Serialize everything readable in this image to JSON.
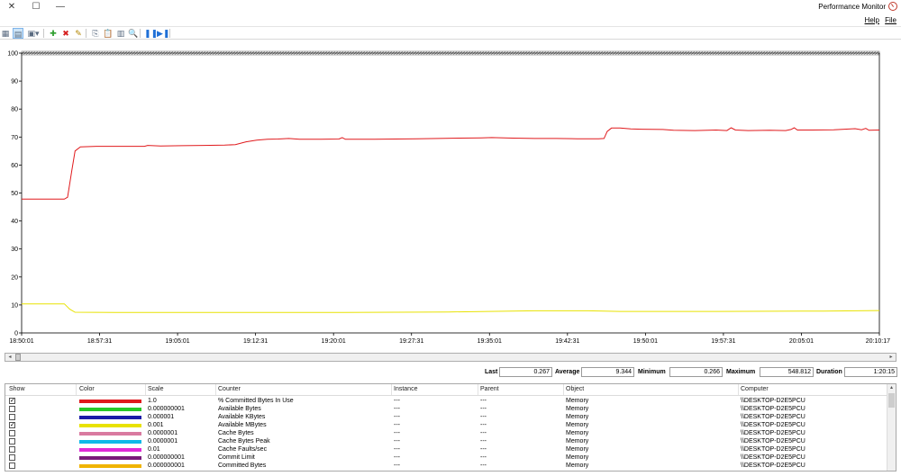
{
  "window": {
    "title": "Performance Monitor",
    "controls": {
      "close": "✕",
      "maximize": "☐",
      "minimize": "—"
    }
  },
  "menu": {
    "items": [
      "Help",
      "File"
    ]
  },
  "toolbar": {
    "tools": [
      {
        "name": "change-graph-type-icon",
        "glyph": "▦",
        "active": false
      },
      {
        "name": "view-current-activity-icon",
        "glyph": "▤",
        "active": true
      },
      {
        "name": "change-graph-type-dropdown-icon",
        "glyph": "▣▾",
        "active": false
      },
      {
        "name": "add-counter-icon",
        "glyph": "✚",
        "active": false,
        "color": "#2e9e2e"
      },
      {
        "name": "delete-counter-icon",
        "glyph": "✖",
        "active": false,
        "color": "#d62020"
      },
      {
        "name": "highlight-icon",
        "glyph": "✎",
        "active": false,
        "color": "#b38600"
      },
      {
        "name": "copy-properties-icon",
        "glyph": "⎘",
        "active": false
      },
      {
        "name": "paste-counter-list-icon",
        "glyph": "📋",
        "active": false
      },
      {
        "name": "properties-icon",
        "glyph": "▥",
        "active": false
      },
      {
        "name": "zoom-icon",
        "glyph": "🔍",
        "active": false
      },
      {
        "name": "freeze-display-icon",
        "glyph": "❚❚",
        "active": false,
        "color": "#1f6fd6"
      },
      {
        "name": "update-data-icon",
        "glyph": "▶❚",
        "active": false,
        "color": "#1f6fd6"
      }
    ]
  },
  "chart_data": {
    "type": "line",
    "ylim": [
      0,
      100
    ],
    "yticks": [
      "100",
      "90",
      "80",
      "70",
      "60",
      "50",
      "40",
      "30",
      "20",
      "10",
      "0"
    ],
    "xticks": [
      "18:50:01",
      "18:57:31",
      "19:05:01",
      "19:12:31",
      "19:20:01",
      "19:27:31",
      "19:35:01",
      "19:42:31",
      "19:50:01",
      "19:57:31",
      "20:05:01",
      "20:10:17"
    ],
    "x_range_minutes": [
      0,
      80.27
    ],
    "series": [
      {
        "name": "% Committed Bytes In Use",
        "color": "#e0191c",
        "points": [
          [
            0,
            47.8
          ],
          [
            4,
            47.8
          ],
          [
            4.3,
            48.5
          ],
          [
            4.7,
            58
          ],
          [
            5.0,
            65
          ],
          [
            5.5,
            66.5
          ],
          [
            7,
            66.7
          ],
          [
            10,
            66.7
          ],
          [
            11.5,
            66.7
          ],
          [
            11.8,
            67
          ],
          [
            13,
            66.8
          ],
          [
            15,
            66.9
          ],
          [
            17,
            67
          ],
          [
            19,
            67.1
          ],
          [
            20,
            67.3
          ],
          [
            21,
            68.3
          ],
          [
            22,
            68.9
          ],
          [
            23,
            69.2
          ],
          [
            24,
            69.3
          ],
          [
            25,
            69.5
          ],
          [
            26,
            69.2
          ],
          [
            28,
            69.2
          ],
          [
            29.7,
            69.3
          ],
          [
            30,
            69.8
          ],
          [
            30.3,
            69.2
          ],
          [
            33,
            69.2
          ],
          [
            35,
            69.3
          ],
          [
            37,
            69.4
          ],
          [
            39,
            69.5
          ],
          [
            41,
            69.6
          ],
          [
            43,
            69.7
          ],
          [
            44,
            69.8
          ],
          [
            46,
            69.6
          ],
          [
            48,
            69.5
          ],
          [
            50,
            69.5
          ],
          [
            52,
            69.4
          ],
          [
            54,
            69.4
          ],
          [
            54.5,
            69.5
          ],
          [
            54.8,
            72
          ],
          [
            55.2,
            73.2
          ],
          [
            56,
            73.2
          ],
          [
            57,
            72.9
          ],
          [
            58,
            72.8
          ],
          [
            60,
            72.7
          ],
          [
            61,
            72.4
          ],
          [
            63,
            72.3
          ],
          [
            65,
            72.5
          ],
          [
            66,
            72.3
          ],
          [
            66.4,
            73.3
          ],
          [
            66.8,
            72.5
          ],
          [
            68,
            72.3
          ],
          [
            70,
            72.4
          ],
          [
            71.5,
            72.3
          ],
          [
            72,
            72.7
          ],
          [
            72.3,
            73.3
          ],
          [
            72.6,
            72.5
          ],
          [
            74,
            72.5
          ],
          [
            76,
            72.6
          ],
          [
            77,
            72.8
          ],
          [
            78,
            73.0
          ],
          [
            78.6,
            72.6
          ],
          [
            79,
            73.1
          ],
          [
            79.3,
            72.4
          ],
          [
            80.27,
            72.5
          ]
        ]
      },
      {
        "name": "Available MBytes",
        "color": "#e8e200",
        "points": [
          [
            0,
            10.4
          ],
          [
            4,
            10.4
          ],
          [
            4.5,
            8.5
          ],
          [
            5,
            7.4
          ],
          [
            10,
            7.3
          ],
          [
            20,
            7.3
          ],
          [
            30,
            7.3
          ],
          [
            40,
            7.5
          ],
          [
            48,
            7.9
          ],
          [
            53,
            7.9
          ],
          [
            56,
            7.7
          ],
          [
            65,
            7.7
          ],
          [
            75,
            7.8
          ],
          [
            80.27,
            8.0
          ]
        ]
      }
    ]
  },
  "stats": {
    "last_label": "Last",
    "last_value": "0.267",
    "average_label": "Average",
    "average_value": "9.344",
    "minimum_label": "Minimum",
    "minimum_value": "0.266",
    "maximum_label": "Maximum",
    "maximum_value": "548.812",
    "duration_label": "Duration",
    "duration_value": "1:20:15"
  },
  "counters": {
    "headers": [
      "Show",
      "Color",
      "Scale",
      "Counter",
      "Instance",
      "Parent",
      "Object",
      "Computer"
    ],
    "rows": [
      {
        "show": true,
        "color": "#e0191c",
        "scale": "1.0",
        "counter": "% Committed Bytes In Use",
        "instance": "---",
        "parent": "---",
        "object": "Memory",
        "computer": "\\\\DESKTOP-D2E5PCU"
      },
      {
        "show": false,
        "color": "#28c828",
        "scale": "0.000000001",
        "counter": "Available Bytes",
        "instance": "---",
        "parent": "---",
        "object": "Memory",
        "computer": "\\\\DESKTOP-D2E5PCU"
      },
      {
        "show": false,
        "color": "#1a1aa8",
        "scale": "0.000001",
        "counter": "Available KBytes",
        "instance": "---",
        "parent": "---",
        "object": "Memory",
        "computer": "\\\\DESKTOP-D2E5PCU"
      },
      {
        "show": true,
        "color": "#e8e200",
        "scale": "0.001",
        "counter": "Available MBytes",
        "instance": "---",
        "parent": "---",
        "object": "Memory",
        "computer": "\\\\DESKTOP-D2E5PCU"
      },
      {
        "show": false,
        "color": "#d97aa0",
        "scale": "0.0000001",
        "counter": "Cache Bytes",
        "instance": "---",
        "parent": "---",
        "object": "Memory",
        "computer": "\\\\DESKTOP-D2E5PCU"
      },
      {
        "show": false,
        "color": "#10b8e8",
        "scale": "0.0000001",
        "counter": "Cache Bytes Peak",
        "instance": "---",
        "parent": "---",
        "object": "Memory",
        "computer": "\\\\DESKTOP-D2E5PCU"
      },
      {
        "show": false,
        "color": "#e02ad8",
        "scale": "0.01",
        "counter": "Cache Faults/sec",
        "instance": "---",
        "parent": "---",
        "object": "Memory",
        "computer": "\\\\DESKTOP-D2E5PCU"
      },
      {
        "show": false,
        "color": "#7a1a7a",
        "scale": "0.000000001",
        "counter": "Commit Limit",
        "instance": "---",
        "parent": "---",
        "object": "Memory",
        "computer": "\\\\DESKTOP-D2E5PCU"
      },
      {
        "show": false,
        "color": "#f0b400",
        "scale": "0.000000001",
        "counter": "Committed Bytes",
        "instance": "---",
        "parent": "---",
        "object": "Memory",
        "computer": "\\\\DESKTOP-D2E5PCU"
      }
    ]
  },
  "scroll": {
    "left_arrow": "◂",
    "right_arrow": "▸",
    "up_arrow": "▴"
  }
}
